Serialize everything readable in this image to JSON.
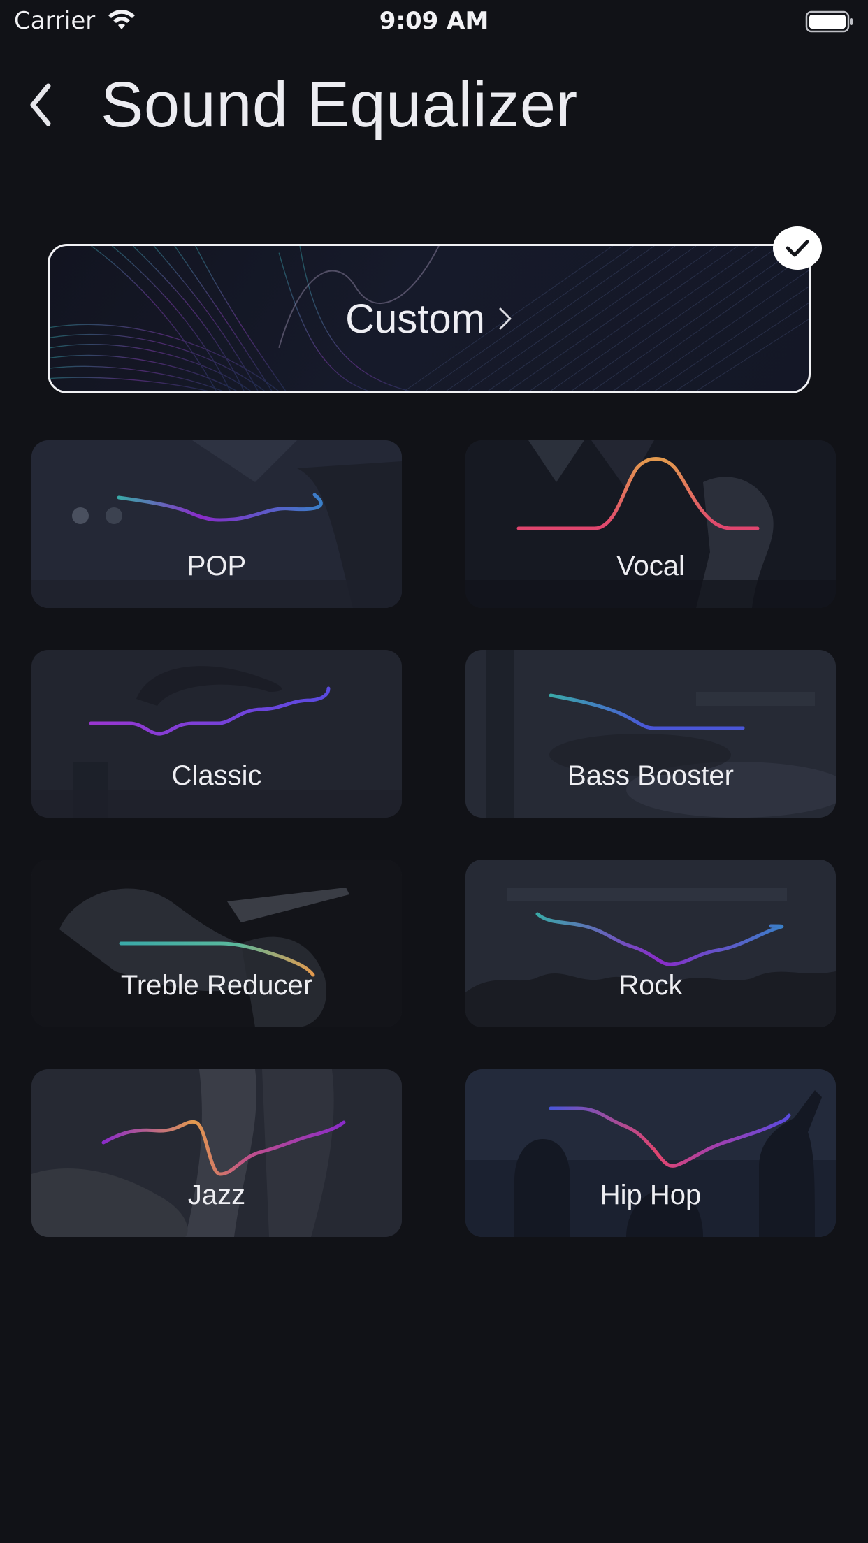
{
  "status_bar": {
    "carrier": "Carrier",
    "time": "9:09 AM",
    "icons": [
      "wifi-icon",
      "battery-icon"
    ]
  },
  "header": {
    "back_icon": "chevron-left-icon",
    "title": "Sound Equalizer"
  },
  "custom": {
    "label": "Custom",
    "selected": true,
    "icons": [
      "chevron-right-icon",
      "checkmark-icon"
    ]
  },
  "presets": [
    {
      "label": "POP"
    },
    {
      "label": "Vocal"
    },
    {
      "label": "Classic"
    },
    {
      "label": "Bass Booster"
    },
    {
      "label": "Treble Reducer"
    },
    {
      "label": "Rock"
    },
    {
      "label": "Jazz"
    },
    {
      "label": "Hip Hop"
    }
  ],
  "colors": {
    "background": "#111217",
    "card_border": "#f1f1f4",
    "teal": "#3aa9a8",
    "purple": "#8a2bc9",
    "pink": "#e0456f",
    "orange": "#e39a4e",
    "indigo": "#5a4be0"
  }
}
